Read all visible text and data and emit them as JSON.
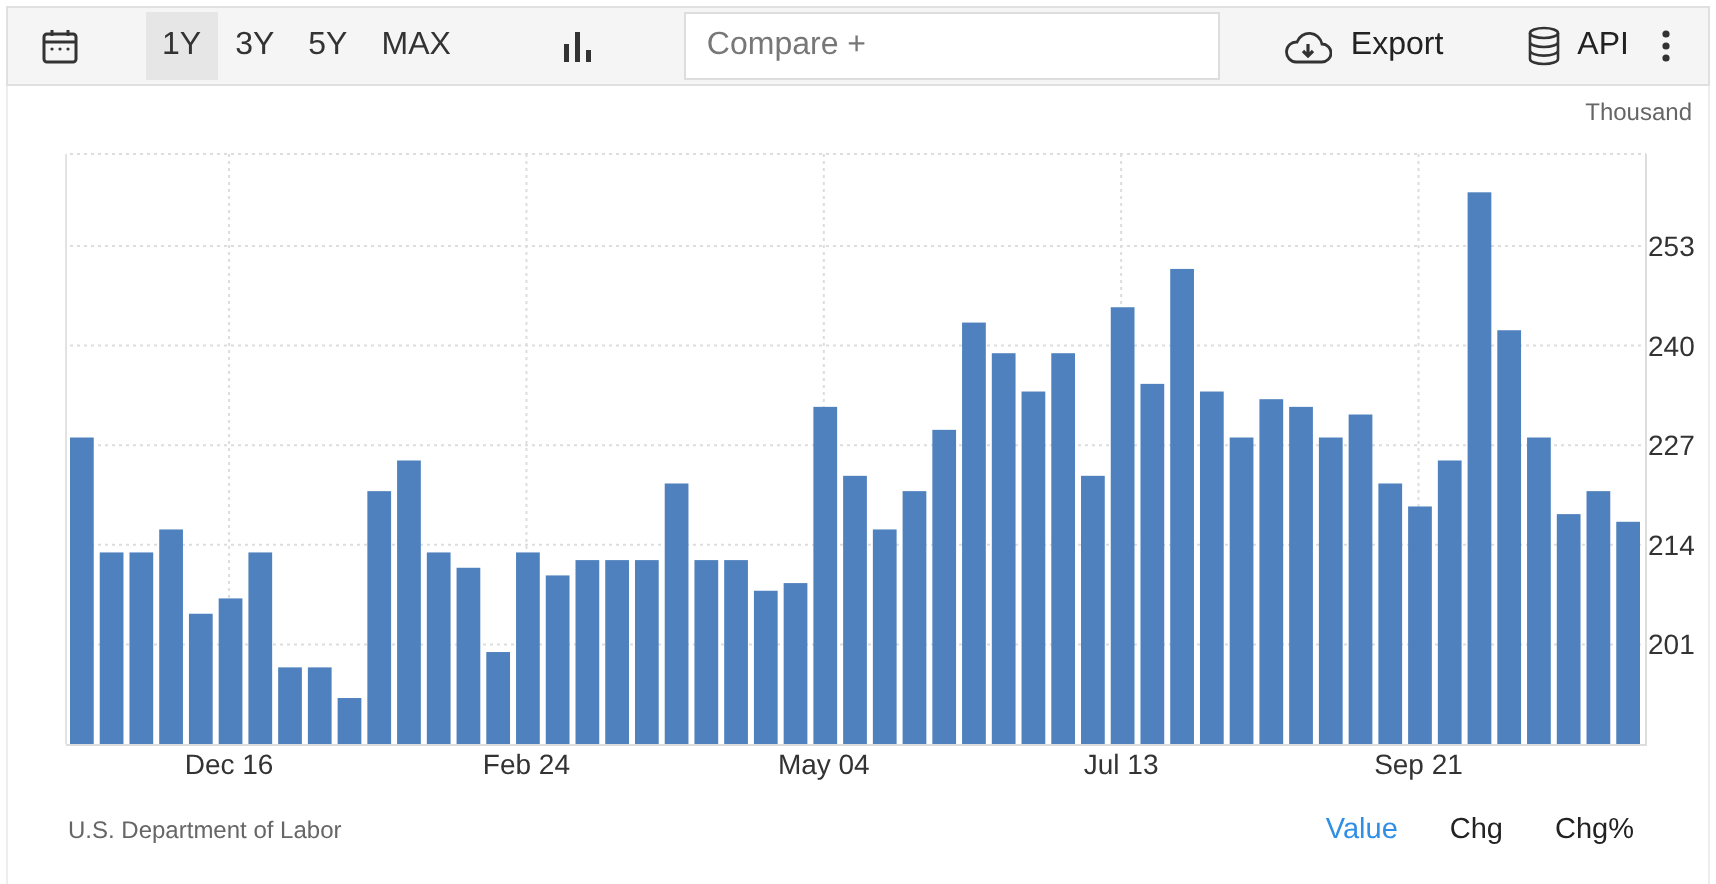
{
  "toolbar": {
    "ranges": [
      {
        "label": "1Y",
        "selected": true
      },
      {
        "label": "3Y",
        "selected": false
      },
      {
        "label": "5Y",
        "selected": false
      },
      {
        "label": "MAX",
        "selected": false
      }
    ],
    "compare": {
      "placeholder": "Compare +"
    },
    "export": {
      "label": "Export"
    },
    "api": {
      "label": "API"
    }
  },
  "chart": {
    "unit_label": "Thousand",
    "chart_data": {
      "type": "bar",
      "grid": true,
      "ylim": [
        188,
        265
      ],
      "yticks": [
        201,
        214,
        227,
        240,
        253
      ],
      "categories": [
        null,
        null,
        null,
        null,
        null,
        "Dec 16",
        null,
        null,
        null,
        null,
        null,
        null,
        null,
        null,
        null,
        "Feb 24",
        null,
        null,
        null,
        null,
        null,
        null,
        null,
        null,
        null,
        "May 04",
        null,
        null,
        null,
        null,
        null,
        null,
        null,
        null,
        null,
        "Jul 13",
        null,
        null,
        null,
        null,
        null,
        null,
        null,
        null,
        null,
        "Sep 21",
        null,
        null,
        null,
        null,
        null,
        null,
        null
      ],
      "series": [
        {
          "color": "#4e81bd",
          "values": [
            228,
            213,
            213,
            216,
            205,
            207,
            213,
            198,
            198,
            194,
            221,
            225,
            213,
            211,
            200,
            213,
            210,
            212,
            212,
            212,
            222,
            212,
            212,
            208,
            209,
            232,
            223,
            216,
            221,
            229,
            243,
            239,
            234,
            239,
            223,
            245,
            235,
            250,
            234,
            228,
            233,
            232,
            228,
            231,
            222,
            219,
            225,
            260,
            242,
            228,
            218,
            221,
            217
          ]
        }
      ]
    }
  },
  "footer": {
    "source": "U.S. Department of Labor",
    "views": [
      {
        "label": "Value",
        "selected": true
      },
      {
        "label": "Chg",
        "selected": false
      },
      {
        "label": "Chg%",
        "selected": false
      }
    ]
  }
}
